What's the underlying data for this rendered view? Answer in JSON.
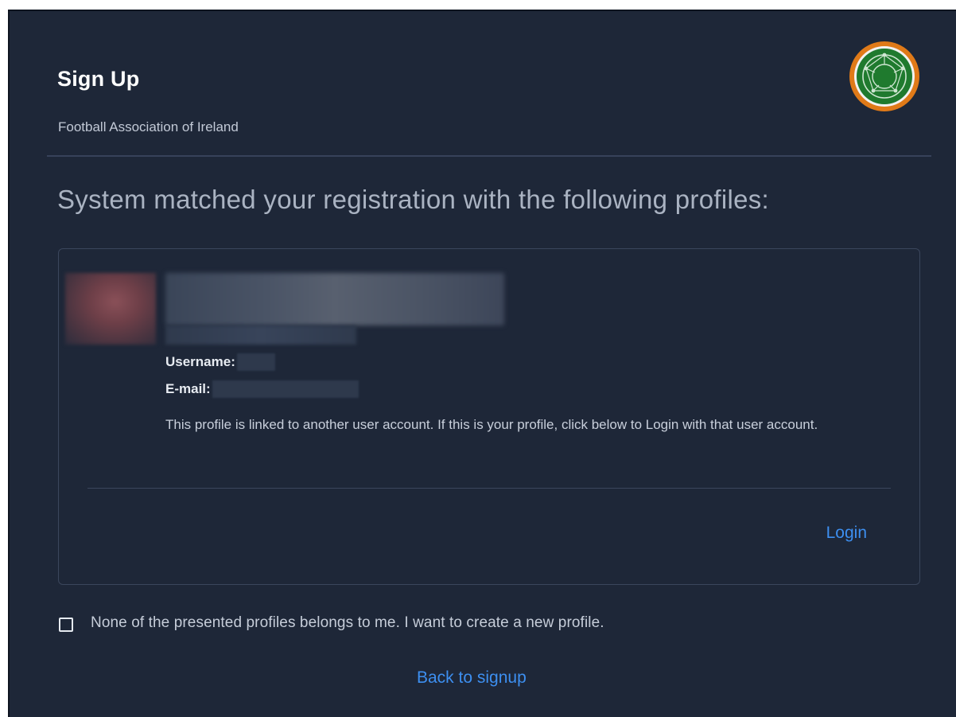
{
  "header": {
    "title": "Sign Up",
    "subtitle": "Football Association of Ireland"
  },
  "logo": {
    "icon": "fai-crest-icon",
    "ring_color": "#e07a18",
    "inner_color": "#1f7a2e"
  },
  "main": {
    "heading": "System matched your registration with the following profiles:"
  },
  "profile": {
    "username_label": "Username:",
    "email_label": "E-mail:",
    "notice": "This profile is linked to another user account. If this is your profile, click below to Login with that user account.",
    "login_label": "Login"
  },
  "options": {
    "none_mine_label": "None of the presented profiles belongs to me. I want to create a new profile.",
    "none_mine_checked": false
  },
  "footer": {
    "back_label": "Back to signup"
  },
  "colors": {
    "background": "#1e2738",
    "link": "#3d8ff0",
    "divider": "#37425a"
  }
}
